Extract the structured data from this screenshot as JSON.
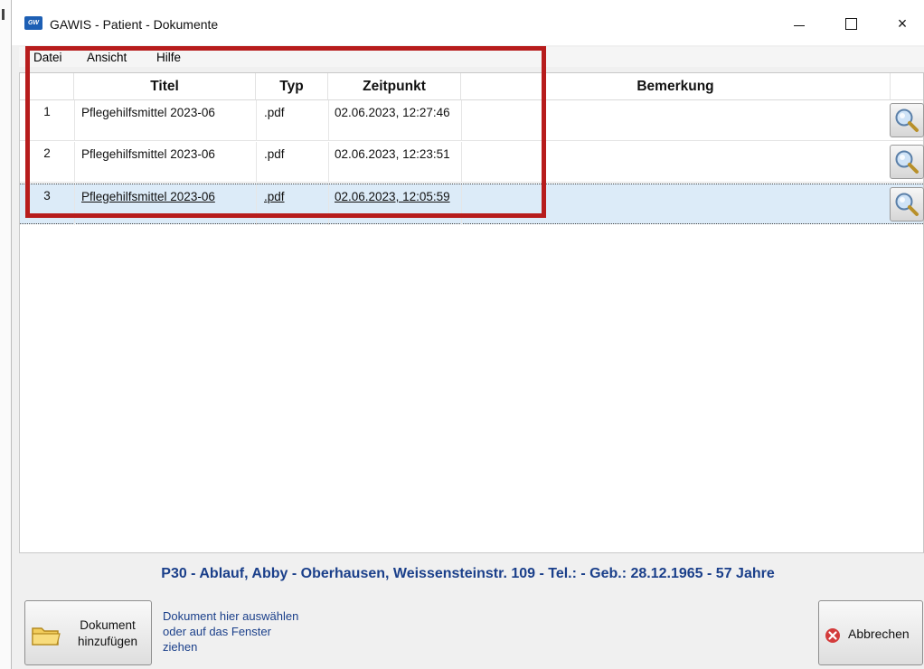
{
  "window": {
    "title": "GAWIS - Patient - Dokumente",
    "app_icon_text": "GW",
    "controls": {
      "minimize": "minimize",
      "maximize": "maximize",
      "close": "×"
    }
  },
  "menu": {
    "items": [
      "Datei",
      "Ansicht",
      "Hilfe"
    ]
  },
  "table": {
    "columns": [
      "",
      "Titel",
      "Typ",
      "Zeitpunkt",
      "Bemerkung",
      ""
    ],
    "rows": [
      {
        "num": "1",
        "titel": "Pflegehilfsmittel 2023-06",
        "typ": ".pdf",
        "zeitpunkt": "02.06.2023, 12:27:46",
        "bemerkung": ""
      },
      {
        "num": "2",
        "titel": "Pflegehilfsmittel 2023-06",
        "typ": ".pdf",
        "zeitpunkt": "02.06.2023, 12:23:51",
        "bemerkung": ""
      },
      {
        "num": "3",
        "titel": "Pflegehilfsmittel 2023-06",
        "typ": ".pdf",
        "zeitpunkt": "02.06.2023, 12:05:59",
        "bemerkung": "",
        "selected": true
      }
    ],
    "row_action_icon": "magnifier-icon"
  },
  "patient_info": "P30 - Ablauf, Abby - Oberhausen, Weissensteinstr. 109 - Tel.:  - Geb.: 28.12.1965 - 57 Jahre",
  "footer": {
    "add_button_line1": "Dokument",
    "add_button_line2": "hinzufügen",
    "hint_line1": "Dokument hier auswählen",
    "hint_line2": "oder auf das Fenster",
    "hint_line3": "ziehen",
    "cancel_label": "Abbrechen"
  },
  "colors": {
    "accent": "#1a3f8a",
    "selection": "#dcebf8",
    "highlight_frame": "#b71c1c",
    "cancel_icon": "#d33b3b"
  }
}
